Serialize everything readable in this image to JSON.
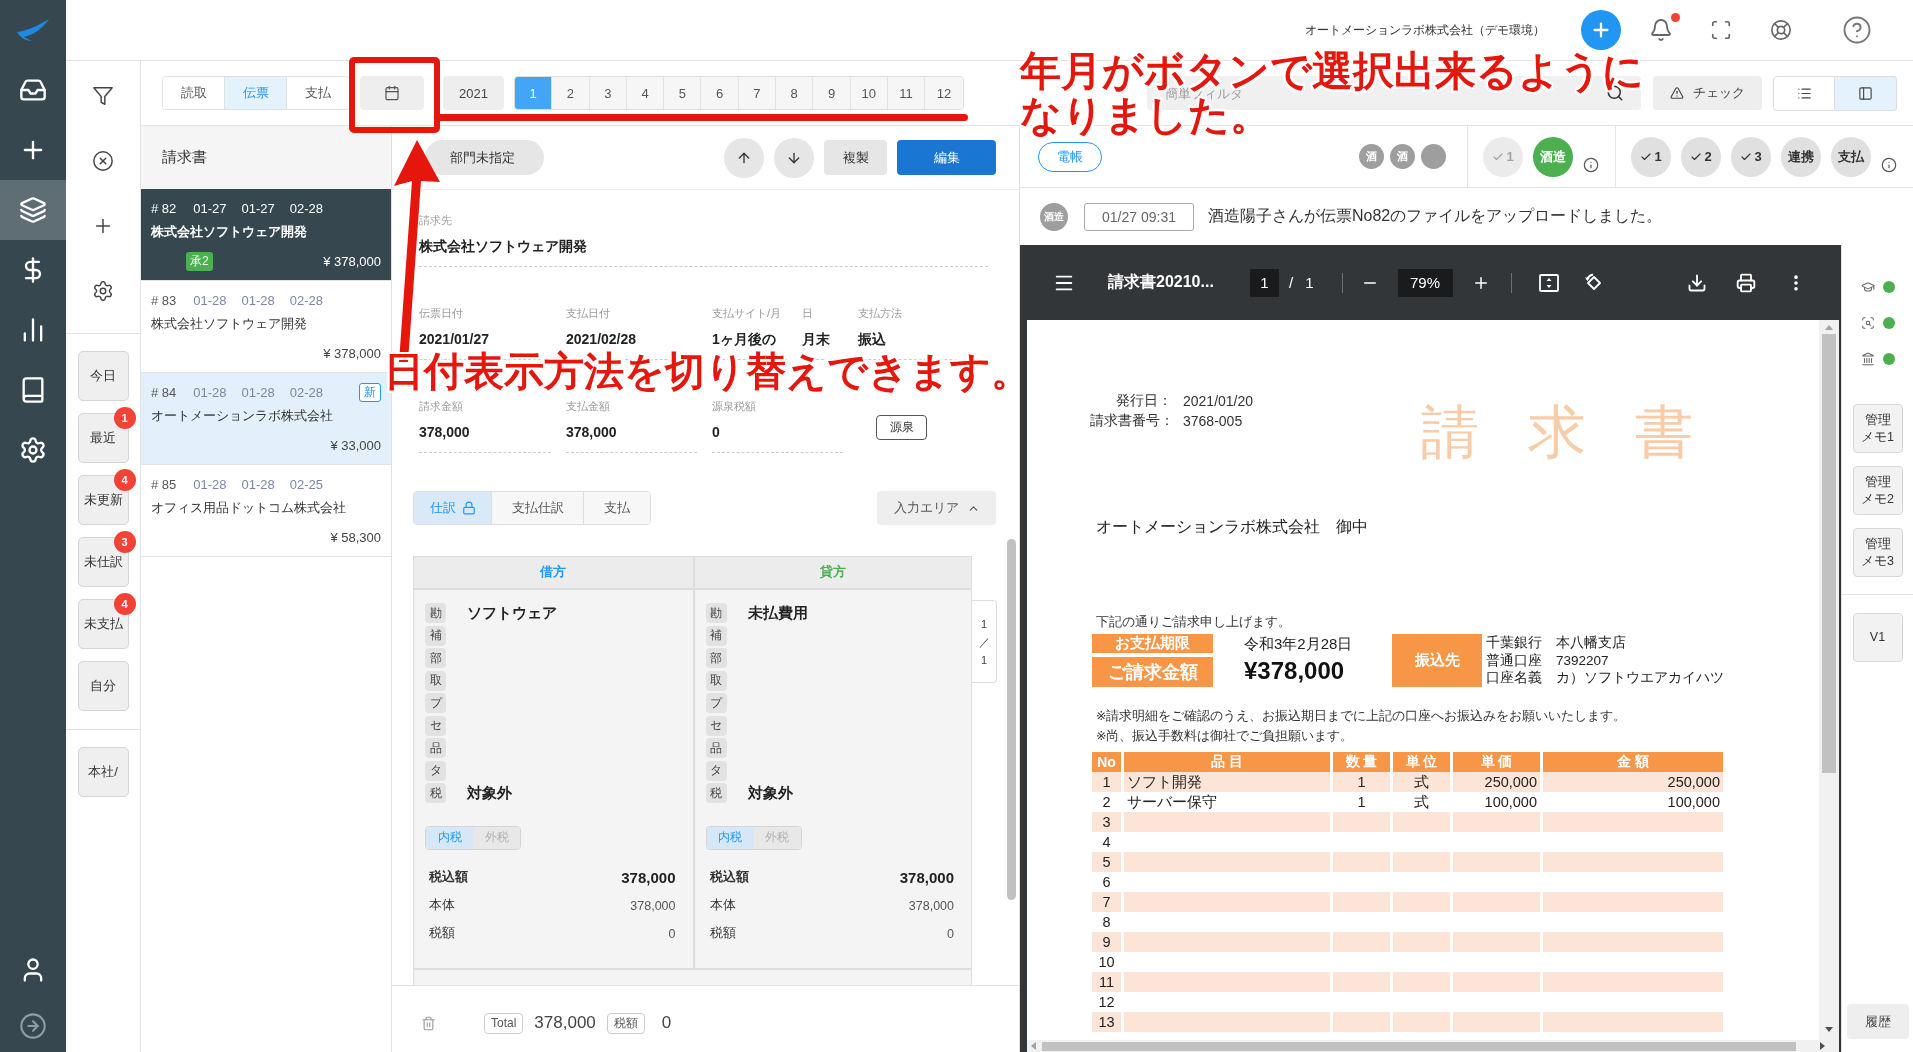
{
  "nav_rail": {
    "items": [
      {
        "selected": false
      },
      {
        "selected": false
      },
      {
        "selected": true
      },
      {
        "selected": false
      },
      {
        "selected": false
      },
      {
        "selected": false
      },
      {
        "selected": false
      }
    ]
  },
  "header": {
    "company": "オートメーションラボ株式会社（デモ環境）",
    "has_unread_notifications": true
  },
  "filter_panel": {
    "quick_filters": [
      {
        "label": "今日"
      },
      {
        "label": "最近",
        "count": "1"
      },
      {
        "label": "未更新",
        "count": "4"
      },
      {
        "label": "未仕訳",
        "count": "3"
      },
      {
        "label": "未支払",
        "count": "4"
      },
      {
        "label": "自分"
      }
    ],
    "branch_filter": "本社/"
  },
  "toolbar": {
    "source_tabs": [
      {
        "label": "読取",
        "selected": false
      },
      {
        "label": "伝票",
        "selected": true
      },
      {
        "label": "支払",
        "selected": false
      }
    ],
    "year": "2021",
    "months": [
      {
        "label": "1",
        "selected": true
      },
      {
        "label": "2",
        "selected": false
      },
      {
        "label": "3",
        "selected": false
      },
      {
        "label": "4",
        "selected": false
      },
      {
        "label": "5",
        "selected": false
      },
      {
        "label": "6",
        "selected": false
      },
      {
        "label": "7",
        "selected": false
      },
      {
        "label": "8",
        "selected": false
      },
      {
        "label": "9",
        "selected": false
      },
      {
        "label": "10",
        "selected": false
      },
      {
        "label": "11",
        "selected": false
      },
      {
        "label": "12",
        "selected": false
      }
    ],
    "search": {
      "placeholder": "簡単フィルタ"
    },
    "check_button": "チェック",
    "view_modes": [
      {
        "selected": false
      },
      {
        "selected": true
      }
    ]
  },
  "list": {
    "title": "請求書",
    "items": [
      {
        "number": "# 82",
        "dates": [
          "01-27",
          "01-27",
          "02-28"
        ],
        "name": "株式会社ソフトウェア開発",
        "amount": "¥ 378,000",
        "selected": true,
        "unread": false,
        "badge": {
          "kind": "approval",
          "label": "承2"
        }
      },
      {
        "number": "# 83",
        "dates": [
          "01-28",
          "01-28",
          "02-28"
        ],
        "name": "株式会社ソフトウェア開発",
        "amount": "¥ 378,000",
        "selected": false,
        "unread": false
      },
      {
        "number": "# 84",
        "dates": [
          "01-28",
          "01-28",
          "02-28"
        ],
        "name": "オートメーションラボ株式会社",
        "amount": "¥ 33,000",
        "selected": false,
        "unread": true,
        "badge": {
          "kind": "new",
          "label": "新"
        }
      },
      {
        "number": "# 85",
        "dates": [
          "01-28",
          "01-28",
          "02-25"
        ],
        "name": "オフィス用品ドットコム株式会社",
        "amount": "¥ 58,300",
        "selected": false,
        "unread": false
      }
    ]
  },
  "form": {
    "department": "部門未指定",
    "copy_button": "複製",
    "edit_button": "編集",
    "field_rows": [
      {
        "fields": [
          {
            "label": "請求先",
            "value": "株式会社ソフトウェア開発"
          }
        ]
      },
      {
        "fields": [
          {
            "label": "伝票日付",
            "value": "2021/01/27"
          },
          {
            "label": "支払日付",
            "value": "2021/02/28"
          },
          {
            "label": "支払サイト/月",
            "value": "1ヶ月後の"
          },
          {
            "label": "日",
            "value": "月末"
          },
          {
            "label": "支払方法",
            "value": "振込"
          }
        ]
      },
      {
        "fields": [
          {
            "label": "請求金額",
            "value": "378,000"
          },
          {
            "label": "支払金額",
            "value": "378,000"
          },
          {
            "label": "源泉税額",
            "value": "0"
          }
        ],
        "button": "源泉"
      }
    ],
    "tabs": [
      {
        "label": "仕訳",
        "selected": true,
        "locked": true
      },
      {
        "label": "支払仕訳",
        "selected": false,
        "locked": false
      },
      {
        "label": "支払",
        "selected": false,
        "locked": false
      }
    ],
    "input_area_button": {
      "label": "入力エリア",
      "expanded": true
    },
    "journal": {
      "sides": [
        {
          "kind": "debit",
          "title": "借方",
          "rows": [
            {
              "tag": "勘",
              "value": "ソフトウェア"
            },
            {
              "tag": "補"
            },
            {
              "tag": "部"
            },
            {
              "tag": "取"
            },
            {
              "tag": "プ"
            },
            {
              "tag": "セ"
            },
            {
              "tag": "品"
            },
            {
              "tag": "タ"
            },
            {
              "tag": "税",
              "value": "対象外"
            }
          ],
          "tax_modes": [
            {
              "label": "内税",
              "selected": true
            },
            {
              "label": "外税",
              "selected": false
            }
          ],
          "totals": [
            {
              "kind": "main",
              "label": "税込額",
              "value": "378,000"
            },
            {
              "kind": "sub",
              "label": "本体",
              "value": "378,000"
            },
            {
              "kind": "sub",
              "label": "税額",
              "value": "0"
            }
          ]
        },
        {
          "kind": "credit",
          "title": "貸方",
          "rows": [
            {
              "tag": "勘",
              "value": "未払費用"
            },
            {
              "tag": "補"
            },
            {
              "tag": "部"
            },
            {
              "tag": "取"
            },
            {
              "tag": "プ"
            },
            {
              "tag": "セ"
            },
            {
              "tag": "品"
            },
            {
              "tag": "タ"
            },
            {
              "tag": "税",
              "value": "対象外"
            }
          ],
          "tax_modes": [
            {
              "label": "内税",
              "selected": true
            },
            {
              "label": "外税",
              "selected": false
            }
          ],
          "totals": [
            {
              "kind": "main",
              "label": "税込額",
              "value": "378,000"
            },
            {
              "kind": "sub",
              "label": "本体",
              "value": "378,000"
            },
            {
              "kind": "sub",
              "label": "税額",
              "value": "0"
            }
          ]
        }
      ],
      "pager": {
        "current": "1",
        "separator": "／",
        "total": "1"
      }
    },
    "footer": {
      "total_label": "Total",
      "total": "378,000",
      "tax_label": "税額",
      "tax": "0"
    }
  },
  "right_panel": {
    "ledger_badge": "電帳",
    "reviewers": [
      {
        "kind": "initial",
        "label": "酒"
      },
      {
        "kind": "initial",
        "label": "酒"
      },
      {
        "kind": "blank"
      }
    ],
    "approval_groups": [
      {
        "steps": [
          {
            "kind": "check",
            "label": "1",
            "approved": false,
            "disabled": true
          },
          {
            "kind": "name",
            "label": "酒造",
            "approved": true,
            "disabled": false
          }
        ]
      },
      {
        "steps": [
          {
            "kind": "check",
            "label": "1",
            "approved": false,
            "disabled": false
          },
          {
            "kind": "check",
            "label": "2",
            "approved": false,
            "disabled": false
          },
          {
            "kind": "check",
            "label": "3",
            "approved": false,
            "disabled": false
          },
          {
            "kind": "name",
            "label": "連携",
            "approved": false,
            "disabled": false
          },
          {
            "kind": "name",
            "label": "支払",
            "approved": false,
            "disabled": false
          }
        ]
      }
    ],
    "activity": {
      "avatar": "酒造",
      "time": "01/27 09:31",
      "message": "酒造陽子さんが伝票No82のファイルをアップロードしました。"
    },
    "pdf_viewer": {
      "title": "請求書20210...",
      "page": "1",
      "page_separator": "/",
      "page_count": "1",
      "zoom": "79%",
      "document": {
        "meta": [
          {
            "label": "発行日：",
            "value": "2021/01/20"
          },
          {
            "label": "請求書番号：",
            "value": "3768-005"
          }
        ],
        "title": "請 求 書",
        "recipient": "オートメーションラボ株式会社　御中",
        "intro": "下記の通りご請求申し上げます。",
        "due_label": "お支払期限",
        "due_date": "令和3年2月28日",
        "amount_label": "ご請求金額",
        "amount": "¥378,000",
        "bank_label": "振込先",
        "bank_lines": [
          "千葉銀行　本八幡支店",
          "普通口座　7392207",
          "口座名義　カ）ソフトウエアカイハツ"
        ],
        "notes": [
          "※請求明細をご確認のうえ、お振込期日までに上記の口座へお振込みをお願いいたします。",
          "※尚、振込手数料は御社でご負担願います。"
        ],
        "table": {
          "columns": [
            "No",
            "品 目",
            "数 量",
            "単 位",
            "単 価",
            "金 額"
          ],
          "rows": [
            [
              "1",
              "ソフト開発",
              "1",
              "式",
              "250,000",
              "250,000"
            ],
            [
              "2",
              "サーバー保守",
              "1",
              "式",
              "100,000",
              "100,000"
            ],
            [
              "3"
            ],
            [
              "4"
            ],
            [
              "5"
            ],
            [
              "6"
            ],
            [
              "7"
            ],
            [
              "8"
            ],
            [
              "9"
            ],
            [
              "10"
            ],
            [
              "11"
            ],
            [
              "12"
            ],
            [
              "13"
            ]
          ]
        }
      }
    },
    "side_strip": {
      "checks": [
        {
          "ok": true
        },
        {
          "ok": true
        },
        {
          "ok": true
        }
      ],
      "memo_buttons": [
        {
          "lines": [
            "管理",
            "メモ1"
          ]
        },
        {
          "lines": [
            "管理",
            "メモ2"
          ]
        },
        {
          "lines": [
            "管理",
            "メモ3"
          ]
        }
      ],
      "version_button": "V1",
      "history_button": "履歴"
    }
  },
  "annotations": [
    {
      "lines": [
        "年月がボタンで選択出来るように",
        "なりました。"
      ]
    },
    {
      "lines": [
        "日付表示方法を切り替えできます。"
      ]
    }
  ]
}
